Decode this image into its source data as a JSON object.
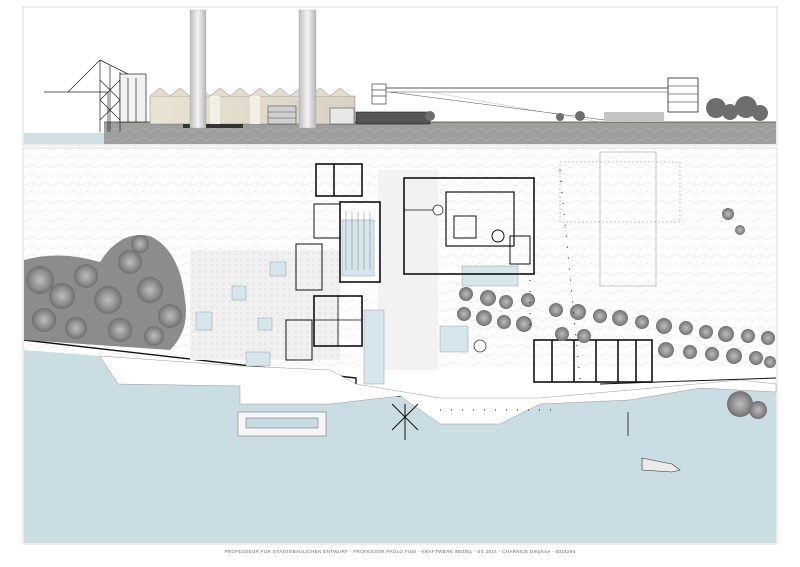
{
  "caption": "PROFESSEUR FÜR STÄDTEBAULICHEN ENTWURF - PROFESSOR PAOLO FUSI - KRAFTWERK WEDEL - SS 2014 - CHARNICE Delphine - 6024266",
  "colors": {
    "water": "#c9dde2",
    "water_strip": "#c2d8de",
    "ground": "#9a9a98",
    "contour": "#d8d8d8",
    "trees": "#8a8a8a",
    "pool": "#cfe3ea",
    "line": "#1a1a1a"
  }
}
